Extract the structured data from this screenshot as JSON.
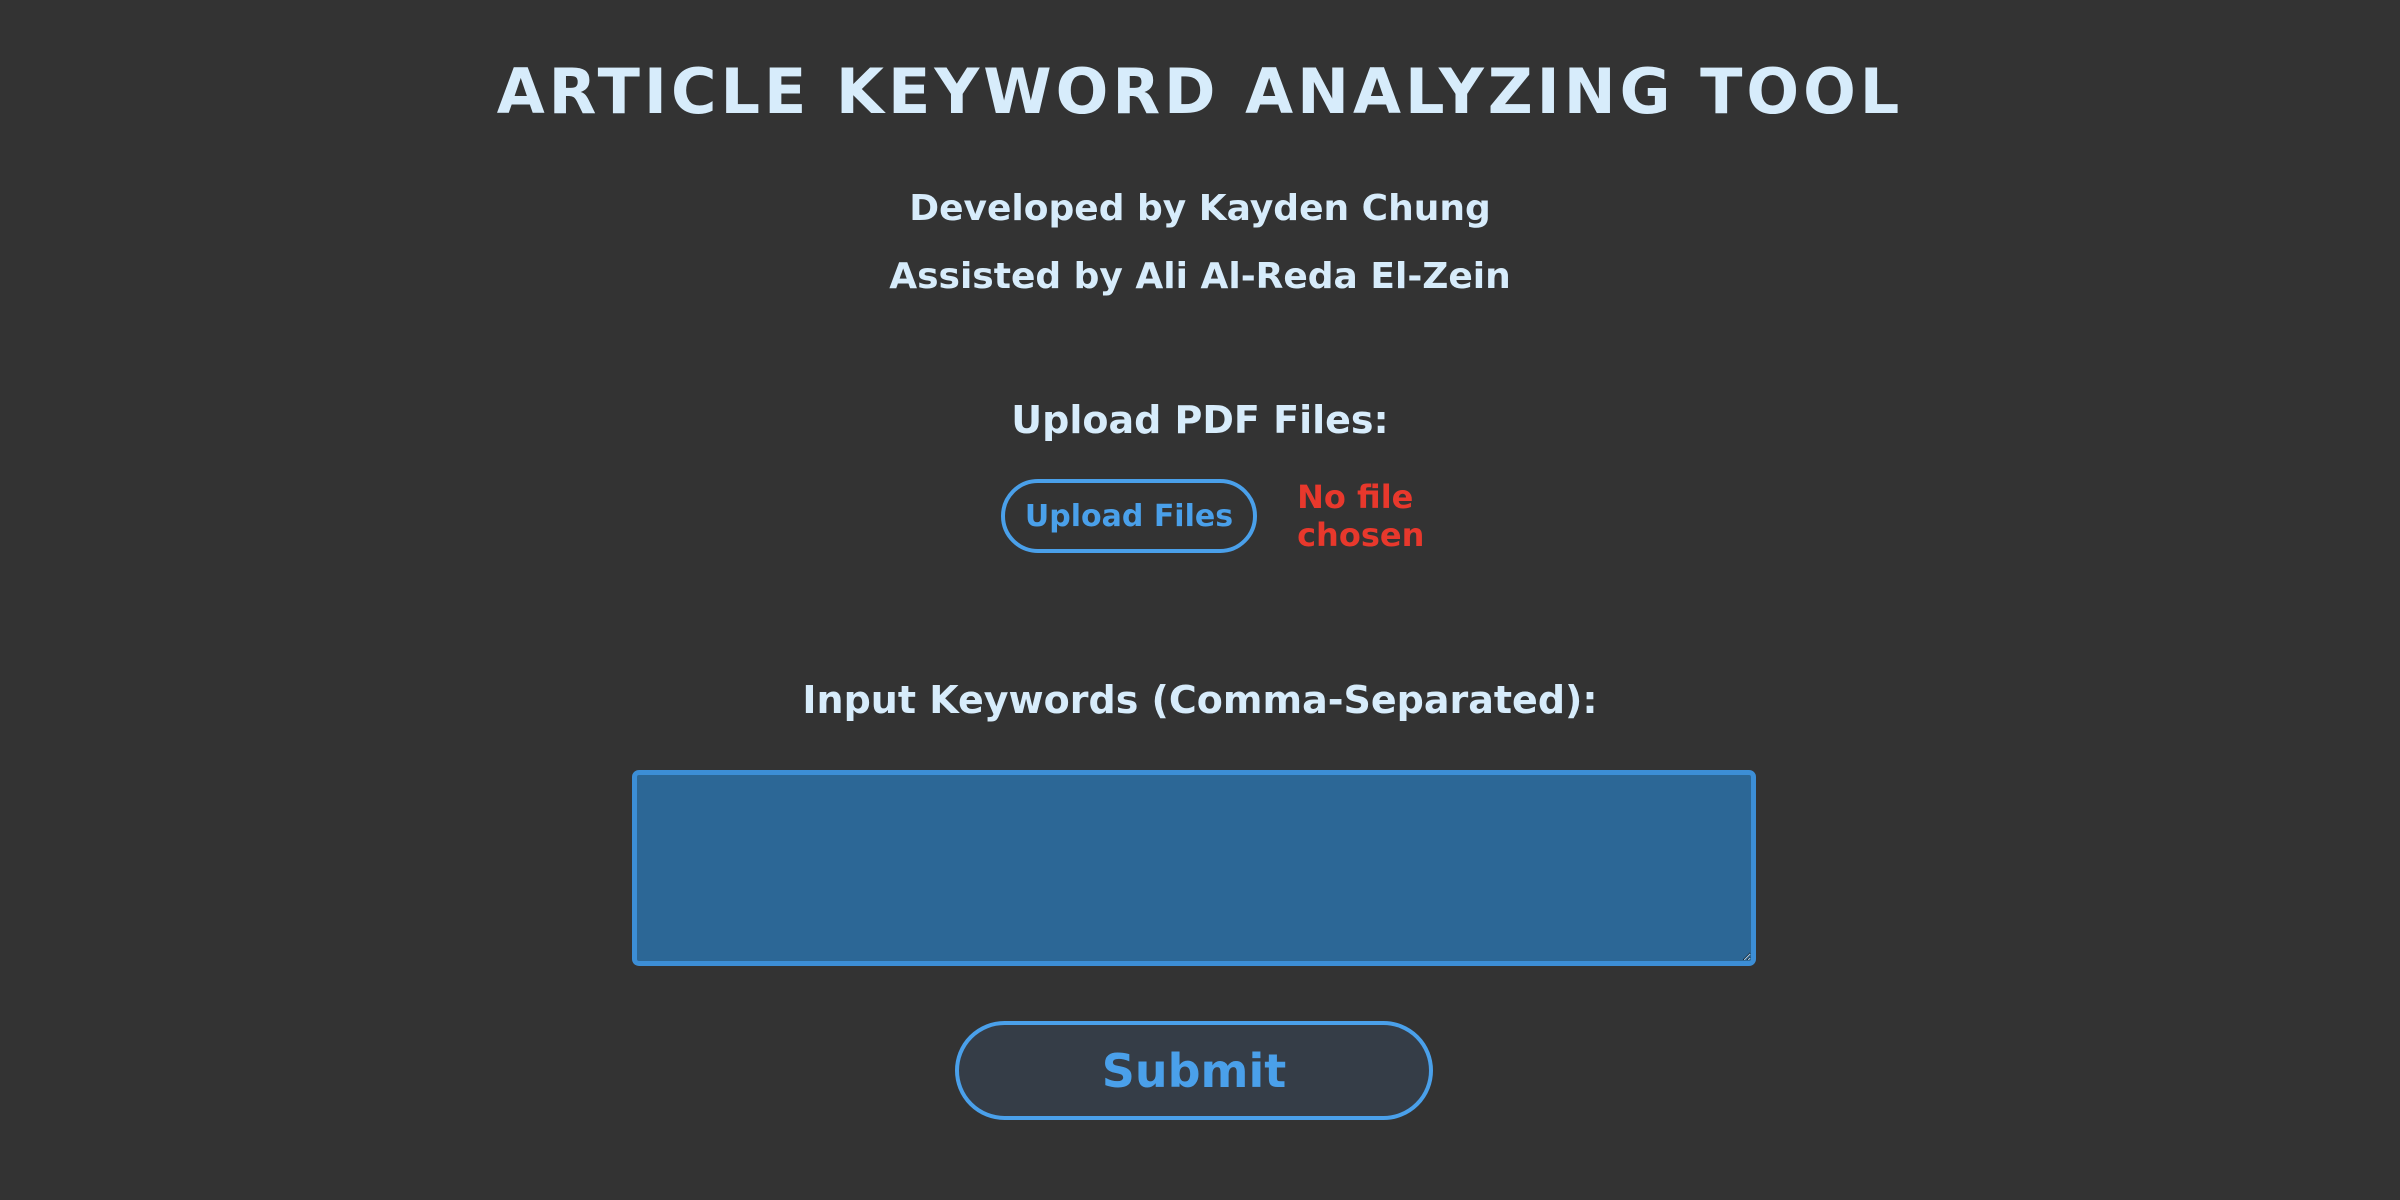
{
  "header": {
    "title": "Article Keyword Analyzing Tool",
    "developed_by": "Developed by Kayden Chung",
    "assisted_by": "Assisted by Ali Al-Reda El-Zein"
  },
  "upload": {
    "label": "Upload PDF Files:",
    "button_label": "Upload Files",
    "status_text": "No file chosen"
  },
  "keywords": {
    "label": "Input Keywords (Comma-Separated):",
    "value": "",
    "placeholder": ""
  },
  "form": {
    "submit_label": "Submit"
  },
  "colors": {
    "background": "#333333",
    "text": "#d7ecfb",
    "accent": "#4aa0ea",
    "status_error": "#e8382c",
    "input_fill": "#2c6796",
    "submit_fill": "#353d47"
  }
}
